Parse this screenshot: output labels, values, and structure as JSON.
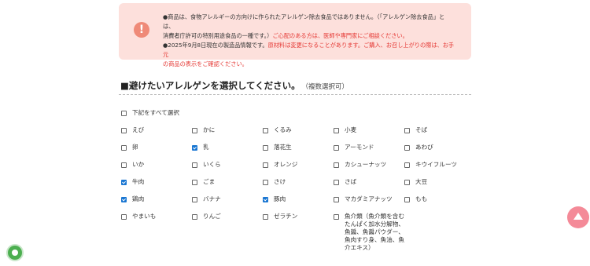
{
  "notice": {
    "icon": "exclamation-icon",
    "line1": "●商品は、食物アレルギーの方向けに作られたアレルゲン除去食品ではありません。（「アレルゲン除去食品」とは、",
    "line2a": "消費者庁許可の特別用途食品の一種です。）",
    "line2b": "ご心配のある方は、医師や専門家にご相談ください。",
    "line3a": "●2025年9月8日現在の製造品情報です。",
    "line3b": "原材料は変更になることがあります。ご購入、お召し上がりの際は、お手元",
    "line4": "の商品の表示をご確認ください。"
  },
  "heading": {
    "title": "■避けたいアレルゲンを選択してください。",
    "sub": "（複数選択可）"
  },
  "select_all": {
    "label": "下記をすべて選択",
    "checked": false
  },
  "allergens": [
    {
      "label": "えび",
      "checked": false
    },
    {
      "label": "かに",
      "checked": false
    },
    {
      "label": "くるみ",
      "checked": false
    },
    {
      "label": "小麦",
      "checked": false
    },
    {
      "label": "そば",
      "checked": false
    },
    {
      "label": "卵",
      "checked": false
    },
    {
      "label": "乳",
      "checked": true
    },
    {
      "label": "落花生",
      "checked": false
    },
    {
      "label": "アーモンド",
      "checked": false
    },
    {
      "label": "あわび",
      "checked": false
    },
    {
      "label": "いか",
      "checked": false
    },
    {
      "label": "いくら",
      "checked": false
    },
    {
      "label": "オレンジ",
      "checked": false
    },
    {
      "label": "カシューナッツ",
      "checked": false
    },
    {
      "label": "キウイフルーツ",
      "checked": false
    },
    {
      "label": "牛肉",
      "checked": true
    },
    {
      "label": "ごま",
      "checked": false
    },
    {
      "label": "さけ",
      "checked": false
    },
    {
      "label": "さば",
      "checked": false
    },
    {
      "label": "大豆",
      "checked": false
    },
    {
      "label": "鶏肉",
      "checked": true
    },
    {
      "label": "バナナ",
      "checked": false
    },
    {
      "label": "豚肉",
      "checked": true
    },
    {
      "label": "マカダミアナッツ",
      "checked": false
    },
    {
      "label": "もも",
      "checked": false
    },
    {
      "label": "やまいも",
      "checked": false
    },
    {
      "label": "りんご",
      "checked": false
    },
    {
      "label": "ゼラチン",
      "checked": false
    },
    {
      "label": "魚介類（魚介類を含むたんぱく加水分解物、魚醤、魚醤パウダー、魚肉すり身、魚油、魚介エキス）",
      "checked": false
    }
  ],
  "colors": {
    "notice_bg": "#fde0dc",
    "notice_red": "#e53935",
    "fab": "#f48a98",
    "checkbox": "#1976d2"
  },
  "widgets": {
    "scroll_top": "arrow-up-icon",
    "accessibility": "accessibility-icon"
  }
}
